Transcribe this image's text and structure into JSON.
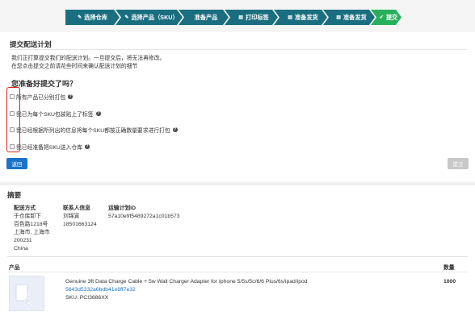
{
  "steps": [
    {
      "icon": "✎",
      "label": "选择仓库"
    },
    {
      "icon": "✎",
      "label": "选择产品（SKU）"
    },
    {
      "icon": "",
      "label": "准备产品"
    },
    {
      "icon": "▤",
      "label": "打印标签"
    },
    {
      "icon": "▤",
      "label": "准备发货"
    },
    {
      "icon": "▤",
      "label": "准备发货"
    },
    {
      "icon": "✔",
      "label": "提交"
    }
  ],
  "plan": {
    "title": "提交配送计划",
    "desc_line1": "我们正打算提交我们的配送计划。一旦提交后，将无法再修改。",
    "desc_line2": "在您点击提交之前请花些时间来确认配送计划的细节"
  },
  "ready": {
    "title": "您准备好提交了吗？",
    "checks": [
      "所有产品已分别打包",
      "我已为每个SKU包装贴上了标签",
      "我已经根据所列出的信息将每个SKU都按正确数量要求进行打包",
      "我已经准备把SKU送入仓库"
    ],
    "help_glyph": "?"
  },
  "buttons": {
    "back": "返回",
    "submit": "提交"
  },
  "summary": {
    "title": "摘要",
    "ship_method_label": "配送方式",
    "ship_method_lines": [
      "于仓库卸下",
      "百色路1218号",
      "上海市, 上海市",
      "200231",
      "China"
    ],
    "contact_label": "联系人信息",
    "contact_name": "刘锦寅",
    "contact_phone": "18501663124",
    "plan_id_label": "运输计划ID",
    "plan_id": "57a10e9f5489272a1c01b573"
  },
  "table": {
    "col_product": "产品",
    "col_qty": "数量",
    "rows": [
      {
        "name": "Genuine 3ft Data Charge Cable + 5w Wall Charger Adapter for Iphone 5/5s/5c/6/6 Plus/6s/ipad/ipod",
        "asin": "5643d5332a6bdb41e8ff7e32",
        "sku": "SKU: PCI3686XX",
        "qty": "1000"
      }
    ]
  },
  "colors": {
    "step": "#1a6e80",
    "step_active": "#27b05c",
    "primary": "#1a73c9",
    "highlight": "#e02020"
  }
}
